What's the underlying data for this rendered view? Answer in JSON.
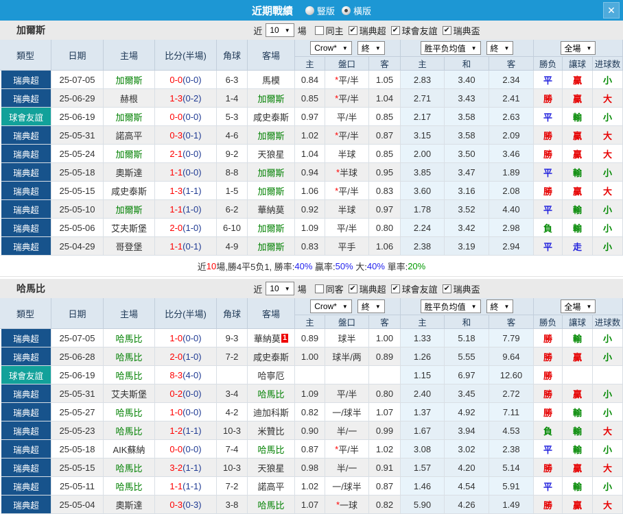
{
  "topbar": {
    "title": "近期戰績",
    "radios": [
      {
        "label": "豎版",
        "selected": false
      },
      {
        "label": "橫版",
        "selected": true
      }
    ],
    "close_icon": "✕"
  },
  "table_header": {
    "static_cols": [
      "類型",
      "日期",
      "主場",
      "比分(半場)",
      "角球",
      "客場"
    ],
    "groups": [
      {
        "selects": [
          "Crow*",
          "終"
        ]
      },
      {
        "selects": [
          "胜平负均值",
          "終"
        ]
      },
      {
        "selects": [
          "全場"
        ]
      }
    ],
    "sub_cols": [
      "主",
      "盤口",
      "客",
      "主",
      "和",
      "客",
      "勝负",
      "讓球",
      "进球数"
    ]
  },
  "outcome_colors": {
    "勝": "#e60000",
    "負": "#008800",
    "平": "#2222dd",
    "贏": "#e60000",
    "輸": "#008800",
    "走": "#2222dd",
    "大": "#e60000",
    "小": "#008800"
  },
  "type_styles": {
    "瑞典超": "league",
    "球會友誼": "friendly",
    "瑞典盃": "league"
  },
  "sections": [
    {
      "team": "加爾斯",
      "filter": {
        "near": "近",
        "count": "10",
        "games": "場",
        "checkboxes": [
          {
            "label": "同主",
            "checked": false
          },
          {
            "label": "瑞典超",
            "checked": true
          },
          {
            "label": "球會友誼",
            "checked": true
          },
          {
            "label": "瑞典盃",
            "checked": true
          }
        ]
      },
      "rows": [
        {
          "type": "瑞典超",
          "date": "25-07-05",
          "home": "加爾斯",
          "ha": true,
          "score": "0-0",
          "half": "(0-0)",
          "corner": "6-3",
          "away": "馬模",
          "aa": false,
          "badge": "",
          "o1": "0.84",
          "line": "*平/半",
          "o2": "1.05",
          "a1": "2.83",
          "a2": "3.40",
          "a3": "2.34",
          "r1": "平",
          "r2": "贏",
          "r3": "小"
        },
        {
          "type": "瑞典超",
          "date": "25-06-29",
          "home": "赫根",
          "ha": false,
          "score": "1-3",
          "half": "(0-2)",
          "corner": "1-4",
          "away": "加爾斯",
          "aa": true,
          "badge": "",
          "o1": "0.85",
          "line": "*平/半",
          "o2": "1.04",
          "a1": "2.71",
          "a2": "3.43",
          "a3": "2.41",
          "r1": "勝",
          "r2": "贏",
          "r3": "大"
        },
        {
          "type": "球會友誼",
          "date": "25-06-19",
          "home": "加爾斯",
          "ha": true,
          "score": "0-0",
          "half": "(0-0)",
          "corner": "5-3",
          "away": "咸史泰斯",
          "aa": false,
          "badge": "",
          "o1": "0.97",
          "line": "平/半",
          "o2": "0.85",
          "a1": "2.17",
          "a2": "3.58",
          "a3": "2.63",
          "r1": "平",
          "r2": "輸",
          "r3": "小"
        },
        {
          "type": "瑞典超",
          "date": "25-05-31",
          "home": "諾高平",
          "ha": false,
          "score": "0-3",
          "half": "(0-1)",
          "corner": "4-6",
          "away": "加爾斯",
          "aa": true,
          "badge": "",
          "o1": "1.02",
          "line": "*平/半",
          "o2": "0.87",
          "a1": "3.15",
          "a2": "3.58",
          "a3": "2.09",
          "r1": "勝",
          "r2": "贏",
          "r3": "大"
        },
        {
          "type": "瑞典超",
          "date": "25-05-24",
          "home": "加爾斯",
          "ha": true,
          "score": "2-1",
          "half": "(0-0)",
          "corner": "9-2",
          "away": "天狼星",
          "aa": false,
          "badge": "",
          "o1": "1.04",
          "line": "半球",
          "o2": "0.85",
          "a1": "2.00",
          "a2": "3.50",
          "a3": "3.46",
          "r1": "勝",
          "r2": "贏",
          "r3": "大"
        },
        {
          "type": "瑞典超",
          "date": "25-05-18",
          "home": "奧斯達",
          "ha": false,
          "score": "1-1",
          "half": "(0-0)",
          "corner": "8-8",
          "away": "加爾斯",
          "aa": true,
          "badge": "",
          "o1": "0.94",
          "line": "*半球",
          "o2": "0.95",
          "a1": "3.85",
          "a2": "3.47",
          "a3": "1.89",
          "r1": "平",
          "r2": "輸",
          "r3": "小"
        },
        {
          "type": "瑞典超",
          "date": "25-05-15",
          "home": "咸史泰斯",
          "ha": false,
          "score": "1-3",
          "half": "(1-1)",
          "corner": "1-5",
          "away": "加爾斯",
          "aa": true,
          "badge": "",
          "o1": "1.06",
          "line": "*平/半",
          "o2": "0.83",
          "a1": "3.60",
          "a2": "3.16",
          "a3": "2.08",
          "r1": "勝",
          "r2": "贏",
          "r3": "大"
        },
        {
          "type": "瑞典超",
          "date": "25-05-10",
          "home": "加爾斯",
          "ha": true,
          "score": "1-1",
          "half": "(1-0)",
          "corner": "6-2",
          "away": "華納莫",
          "aa": false,
          "badge": "",
          "o1": "0.92",
          "line": "半球",
          "o2": "0.97",
          "a1": "1.78",
          "a2": "3.52",
          "a3": "4.40",
          "r1": "平",
          "r2": "輸",
          "r3": "小"
        },
        {
          "type": "瑞典超",
          "date": "25-05-06",
          "home": "艾夫斯堡",
          "ha": false,
          "score": "2-0",
          "half": "(1-0)",
          "corner": "6-10",
          "away": "加爾斯",
          "aa": true,
          "badge": "",
          "o1": "1.09",
          "line": "平/半",
          "o2": "0.80",
          "a1": "2.24",
          "a2": "3.42",
          "a3": "2.98",
          "r1": "負",
          "r2": "輸",
          "r3": "小"
        },
        {
          "type": "瑞典超",
          "date": "25-04-29",
          "home": "哥登堡",
          "ha": false,
          "score": "1-1",
          "half": "(0-1)",
          "corner": "4-9",
          "away": "加爾斯",
          "aa": true,
          "badge": "",
          "o1": "0.83",
          "line": "平手",
          "o2": "1.06",
          "a1": "2.38",
          "a2": "3.19",
          "a3": "2.94",
          "r1": "平",
          "r2": "走",
          "r3": "小"
        }
      ],
      "summary": [
        {
          "t": "近",
          "c": "#333333"
        },
        {
          "t": "10",
          "c": "#ff0000"
        },
        {
          "t": "場,勝4平5负1, 勝率:",
          "c": "#333333"
        },
        {
          "t": "40%",
          "c": "#2222ee"
        },
        {
          "t": " 贏率:",
          "c": "#333333"
        },
        {
          "t": "50%",
          "c": "#2222ee"
        },
        {
          "t": " 大:",
          "c": "#333333"
        },
        {
          "t": "40%",
          "c": "#2222ee"
        },
        {
          "t": " 單率:",
          "c": "#333333"
        },
        {
          "t": "20%",
          "c": "#009900"
        }
      ]
    },
    {
      "team": "哈馬比",
      "filter": {
        "near": "近",
        "count": "10",
        "games": "場",
        "checkboxes": [
          {
            "label": "同客",
            "checked": false
          },
          {
            "label": "瑞典超",
            "checked": true
          },
          {
            "label": "球會友誼",
            "checked": true
          },
          {
            "label": "瑞典盃",
            "checked": true
          }
        ]
      },
      "rows": [
        {
          "type": "瑞典超",
          "date": "25-07-05",
          "home": "哈馬比",
          "ha": true,
          "score": "1-0",
          "half": "(0-0)",
          "corner": "9-3",
          "away": "華納莫",
          "aa": false,
          "badge": "1",
          "o1": "0.89",
          "line": "球半",
          "o2": "1.00",
          "a1": "1.33",
          "a2": "5.18",
          "a3": "7.79",
          "r1": "勝",
          "r2": "輸",
          "r3": "小"
        },
        {
          "type": "瑞典超",
          "date": "25-06-28",
          "home": "哈馬比",
          "ha": true,
          "score": "2-0",
          "half": "(1-0)",
          "corner": "7-2",
          "away": "咸史泰斯",
          "aa": false,
          "badge": "",
          "o1": "1.00",
          "line": "球半/两",
          "o2": "0.89",
          "a1": "1.26",
          "a2": "5.55",
          "a3": "9.64",
          "r1": "勝",
          "r2": "贏",
          "r3": "小"
        },
        {
          "type": "球會友誼",
          "date": "25-06-19",
          "home": "哈馬比",
          "ha": true,
          "score": "8-3",
          "half": "(4-0)",
          "corner": "",
          "away": "哈寧厄",
          "aa": false,
          "badge": "",
          "o1": "",
          "line": "",
          "o2": "",
          "a1": "1.15",
          "a2": "6.97",
          "a3": "12.60",
          "r1": "勝",
          "r2": "",
          "r3": ""
        },
        {
          "type": "瑞典超",
          "date": "25-05-31",
          "home": "艾夫斯堡",
          "ha": false,
          "score": "0-2",
          "half": "(0-0)",
          "corner": "3-4",
          "away": "哈馬比",
          "aa": true,
          "badge": "",
          "o1": "1.09",
          "line": "平/半",
          "o2": "0.80",
          "a1": "2.40",
          "a2": "3.45",
          "a3": "2.72",
          "r1": "勝",
          "r2": "贏",
          "r3": "小"
        },
        {
          "type": "瑞典超",
          "date": "25-05-27",
          "home": "哈馬比",
          "ha": true,
          "score": "1-0",
          "half": "(0-0)",
          "corner": "4-2",
          "away": "迪加科斯",
          "aa": false,
          "badge": "",
          "o1": "0.82",
          "line": "一/球半",
          "o2": "1.07",
          "a1": "1.37",
          "a2": "4.92",
          "a3": "7.11",
          "r1": "勝",
          "r2": "輸",
          "r3": "小"
        },
        {
          "type": "瑞典超",
          "date": "25-05-23",
          "home": "哈馬比",
          "ha": true,
          "score": "1-2",
          "half": "(1-1)",
          "corner": "10-3",
          "away": "米贊比",
          "aa": false,
          "badge": "",
          "o1": "0.90",
          "line": "半/一",
          "o2": "0.99",
          "a1": "1.67",
          "a2": "3.94",
          "a3": "4.53",
          "r1": "負",
          "r2": "輸",
          "r3": "大"
        },
        {
          "type": "瑞典超",
          "date": "25-05-18",
          "home": "AIK蘇納",
          "ha": false,
          "score": "0-0",
          "half": "(0-0)",
          "corner": "7-4",
          "away": "哈馬比",
          "aa": true,
          "badge": "",
          "o1": "0.87",
          "line": "*平/半",
          "o2": "1.02",
          "a1": "3.08",
          "a2": "3.02",
          "a3": "2.38",
          "r1": "平",
          "r2": "輸",
          "r3": "小"
        },
        {
          "type": "瑞典超",
          "date": "25-05-15",
          "home": "哈馬比",
          "ha": true,
          "score": "3-2",
          "half": "(1-1)",
          "corner": "10-3",
          "away": "天狼星",
          "aa": false,
          "badge": "",
          "o1": "0.98",
          "line": "半/一",
          "o2": "0.91",
          "a1": "1.57",
          "a2": "4.20",
          "a3": "5.14",
          "r1": "勝",
          "r2": "贏",
          "r3": "大"
        },
        {
          "type": "瑞典超",
          "date": "25-05-11",
          "home": "哈馬比",
          "ha": true,
          "score": "1-1",
          "half": "(1-1)",
          "corner": "7-2",
          "away": "諾高平",
          "aa": false,
          "badge": "",
          "o1": "1.02",
          "line": "一/球半",
          "o2": "0.87",
          "a1": "1.46",
          "a2": "4.54",
          "a3": "5.91",
          "r1": "平",
          "r2": "輸",
          "r3": "小"
        },
        {
          "type": "瑞典超",
          "date": "25-05-04",
          "home": "奧斯達",
          "ha": false,
          "score": "0-3",
          "half": "(0-3)",
          "corner": "3-8",
          "away": "哈馬比",
          "aa": true,
          "badge": "",
          "o1": "1.07",
          "line": "*一球",
          "o2": "0.82",
          "a1": "5.90",
          "a2": "4.26",
          "a3": "1.49",
          "r1": "勝",
          "r2": "贏",
          "r3": "大"
        }
      ],
      "summary": null
    }
  ]
}
